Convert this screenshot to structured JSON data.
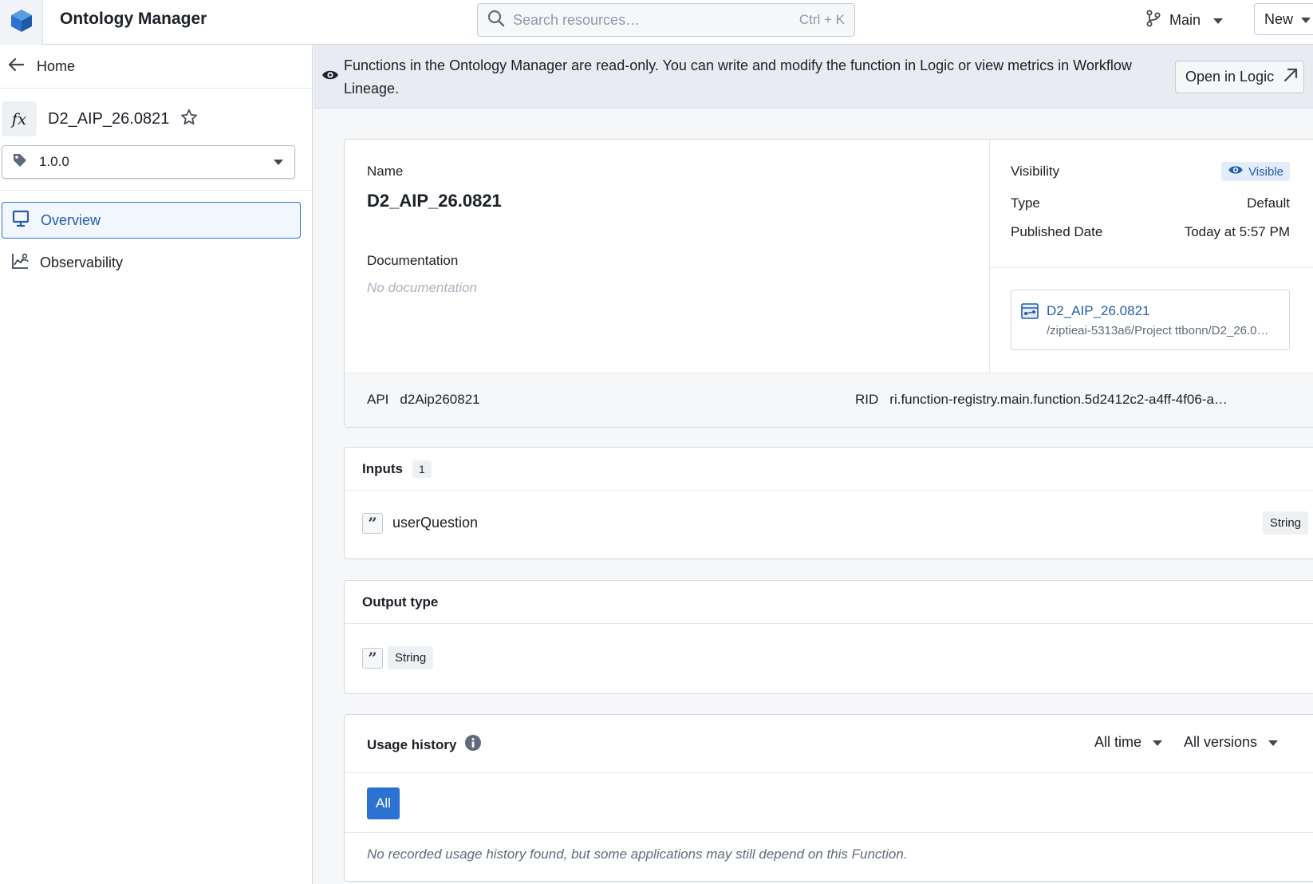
{
  "header": {
    "app_title": "Ontology Manager",
    "logo_icon": "cube-logo-icon",
    "search": {
      "placeholder": "Search resources…",
      "shortcut": "Ctrl + K"
    },
    "branch": "Main",
    "new_label": "New"
  },
  "sidebar": {
    "home_label": "Home",
    "function_icon": "fx",
    "function_name": "D2_AIP_26.0821",
    "version": "1.0.0",
    "nav": [
      {
        "label": "Overview",
        "icon": "desktop-icon",
        "active": true
      },
      {
        "label": "Observability",
        "icon": "chart-person-icon",
        "active": false
      }
    ]
  },
  "banner": {
    "message": "Functions in the Ontology Manager are read-only. You can write and modify the function in Logic or view metrics in Workflow Lineage.",
    "button_label": "Open in Logic"
  },
  "overview": {
    "name_label": "Name",
    "name_value": "D2_AIP_26.0821",
    "documentation_label": "Documentation",
    "documentation_value": "No documentation",
    "visibility_label": "Visibility",
    "visibility_value": "Visible",
    "type_label": "Type",
    "type_value": "Default",
    "published_label": "Published Date",
    "published_value": "Today at 5:57 PM",
    "resource_name": "D2_AIP_26.0821",
    "resource_path": "/ziptieai-5313a6/Project ttbonn/D2_26.0…",
    "api_label": "API",
    "api_value": "d2Aip260821",
    "rid_label": "RID",
    "rid_value": "ri.function-registry.main.function.5d2412c2-a4ff-4f06-a…"
  },
  "inputs": {
    "title": "Inputs",
    "count": "1",
    "items": [
      {
        "name": "userQuestion",
        "type": "String"
      }
    ]
  },
  "output": {
    "title": "Output type",
    "type": "String"
  },
  "usage": {
    "title": "Usage history",
    "time_filter": "All time",
    "version_filter": "All versions",
    "all_label": "All",
    "empty_message": "No recorded usage history found, but some applications may still depend on this Function."
  },
  "colors": {
    "accent": "#2d72d2",
    "link": "#215db0",
    "border": "#d3d8de",
    "banner_bg": "#e8ebef"
  }
}
